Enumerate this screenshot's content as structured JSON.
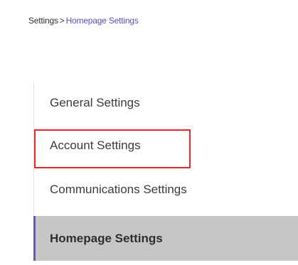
{
  "breadcrumb": {
    "parent": "Settings",
    "separator": ">",
    "current": "Homepage Settings"
  },
  "nav": {
    "items": [
      {
        "label": "General Settings"
      },
      {
        "label": "Account Settings"
      },
      {
        "label": "Communications Settings"
      },
      {
        "label": "Homepage Settings",
        "active": true
      }
    ]
  },
  "colors": {
    "accent": "#6a55c0",
    "active_bg": "#c6c6c6",
    "highlight": "#e02a2a"
  }
}
